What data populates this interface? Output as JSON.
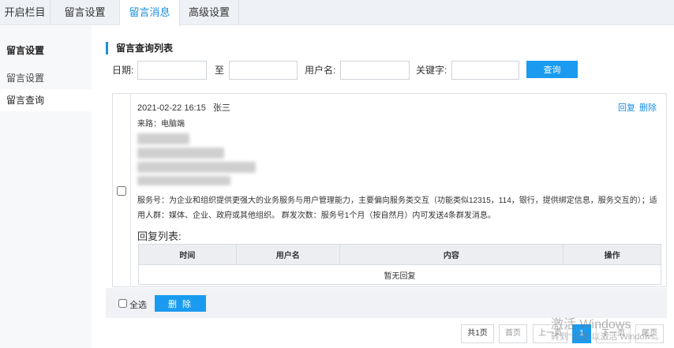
{
  "tabs": [
    {
      "label": "开启栏目"
    },
    {
      "label": "留言设置"
    },
    {
      "label": "留言消息"
    },
    {
      "label": "高级设置"
    }
  ],
  "sidebar": {
    "heading": "留言设置",
    "items": [
      {
        "label": "留言设置"
      },
      {
        "label": "留言查询"
      }
    ]
  },
  "section_title": "留言查询列表",
  "filters": {
    "date_label": "日期:",
    "to_label": "至",
    "user_label": "用户名:",
    "keyword_label": "关键字:",
    "date_from": "",
    "date_to": "",
    "username": "",
    "keyword": "",
    "query_button": "查询"
  },
  "message": {
    "datetime": "2021-02-22 16:15",
    "author": "张三",
    "source": "来路：电脑端",
    "reply_link": "回复",
    "delete_link": "删除",
    "description": "服务号：为企业和组织提供更强大的业务服务与用户管理能力，主要偏向服务类交互（功能类似12315，114，银行，提供绑定信息，服务交互的）；适用人群：媒体、企业、政府或其他组织。 群发次数：服务号1个月（按自然月）内可发送4条群发消息。",
    "reply_list_title": "回复列表:",
    "reply_columns": [
      "时间",
      "用户名",
      "内容",
      "操作"
    ],
    "no_reply": "暂无回复"
  },
  "bottom": {
    "select_all": "全选",
    "delete_button": "删 除"
  },
  "pagination": {
    "total": "共1页",
    "first": "首页",
    "prev": "上一页",
    "current": "1",
    "next": "下一页",
    "last": "尾页"
  },
  "watermark": {
    "line1": "激活 Windows",
    "line2": "转到“设置”以激活 Windows。"
  }
}
